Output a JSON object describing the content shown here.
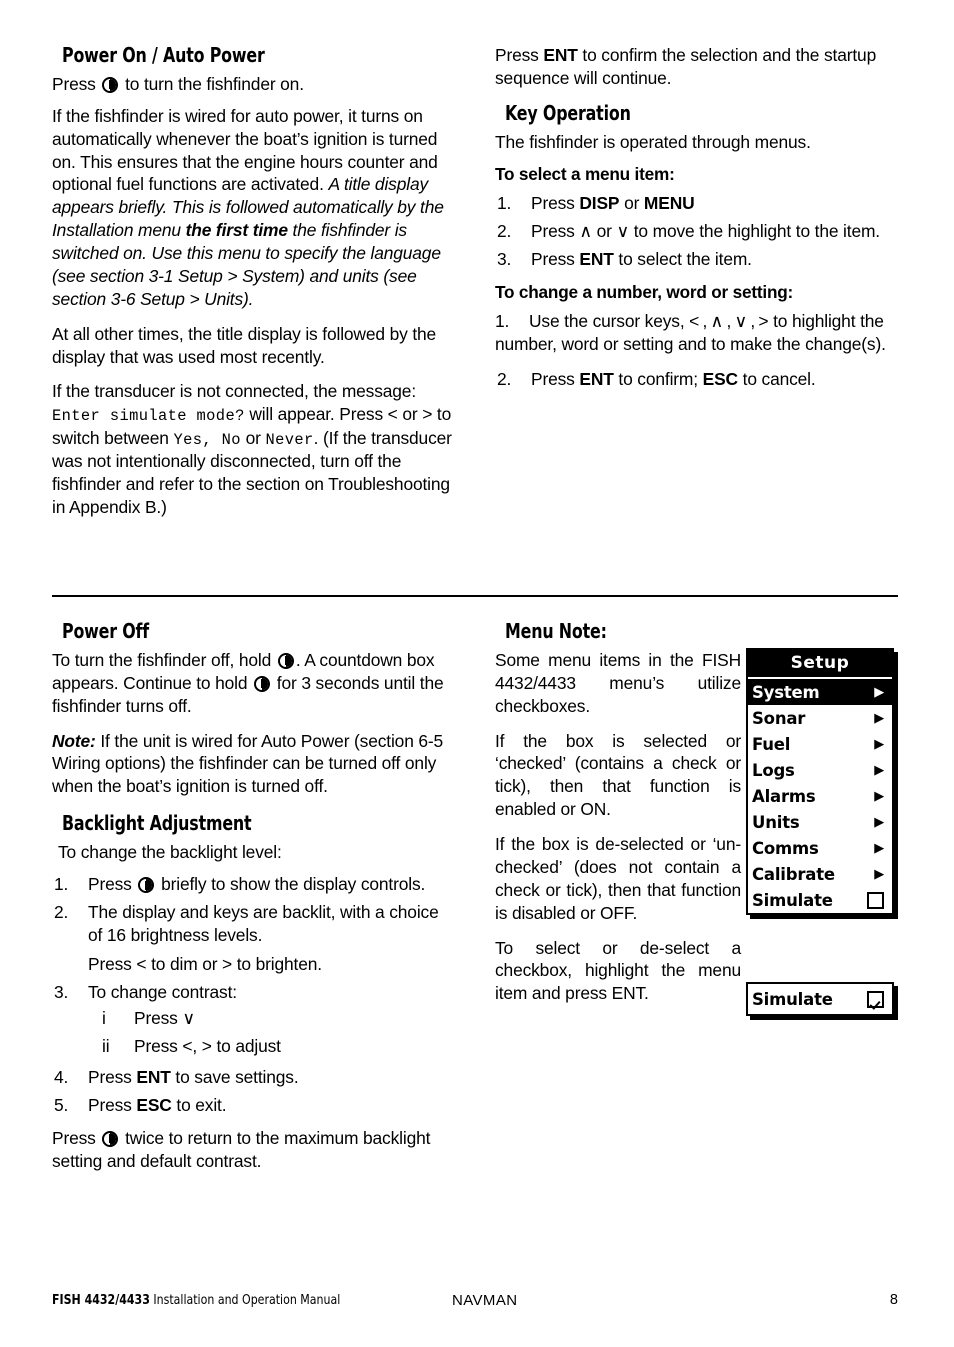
{
  "page": {
    "number": "8",
    "footer_left_bold": "FISH 4432/4433",
    "footer_left_rest": " Installation and Operation Manual",
    "footer_center": "NAVMAN"
  },
  "sections": {
    "power_on": {
      "heading": "Power On / Auto Power",
      "p1_a": "Press ",
      "p1_b": " to turn the fishfinder on.",
      "p2_roman": "If the fishfinder is wired for auto power, it turns on automatically whenever the boat’s ignition is turned on. This ensures that the engine hours counter and optional fuel functions are activated. ",
      "p2_italic_1": "A title display appears briefly. This is followed automatically by the Installation menu ",
      "p2_bold_italic": "the first time",
      "p2_italic_2": " the fishfinder is switched on. Use this menu to specify the language (see section 3-1 Setup > System) and units (see section 3-6 Setup > Units).",
      "p3": "At all other times, the title display is followed by the display that was used most recently.",
      "p4_a": "If the transducer is not connected, the message: ",
      "p4_mono_1": "Enter simulate mode?",
      "p4_b": " will appear. Press < or > to switch between ",
      "p4_mono_2": "Yes, No",
      "p4_c": " or ",
      "p4_mono_3": "Never",
      "p4_d": ". (If the transducer was not intentionally disconnected, turn off the fishfinder and refer to the section on Troubleshooting in Appendix B.)"
    },
    "key_operation": {
      "intro_a": "Press ",
      "intro_b": "ENT",
      "intro_c": " to confirm the selection and the startup sequence will continue.",
      "heading": "Key Operation",
      "lead": "The fishfinder is operated through menus.",
      "sub1": "To select a menu item:",
      "items1": [
        {
          "num": "1.",
          "pre": "Press ",
          "b1": "DISP",
          "mid": " or ",
          "b2": "MENU",
          "post": ""
        },
        {
          "num": "2.",
          "pre": "Press ∧ or ∨ to move the highlight to the item.",
          "b1": "",
          "mid": "",
          "b2": "",
          "post": ""
        },
        {
          "num": "3.",
          "pre": "Press ",
          "b1": "ENT",
          "mid": " to select the item.",
          "b2": "",
          "post": ""
        }
      ],
      "sub2": "To change a number, word or setting:",
      "item2_num": "1.",
      "item2_text": "Use the cursor keys, < , ∧ , ∨ , > to highlight the number, word or setting and to make the change(s).",
      "item3_num": "2.",
      "item3_pre": "Press ",
      "item3_b1": "ENT",
      "item3_mid": " to confirm; ",
      "item3_b2": "ESC",
      "item3_post": " to cancel."
    },
    "power_off": {
      "heading": "Power Off",
      "p1_a": "To turn the fishfinder off, hold ",
      "p1_b": ". A countdown box appears. Continue to hold ",
      "p1_c": " for 3 seconds until the fishfinder turns off.",
      "note_label": "Note:",
      "note_text": " If the unit is wired for Auto Power (section 6-5 Wiring options) the fishfinder can be turned off only when the boat’s ignition is turned off."
    },
    "backlight": {
      "heading": "Backlight Adjustment",
      "lead": "To change the backlight level:",
      "i1_num": "1.",
      "i1_a": "Press ",
      "i1_b": " briefly to show the display controls.",
      "i2_num": "2.",
      "i2_text": "The display and keys are backlit, with a choice of 16 brightness levels.",
      "i2_cont": "Press < to dim or > to brighten.",
      "i3_num": "3.",
      "i3_text": "To change contrast:",
      "i3a_num": "i",
      "i3a_text": "Press ∨",
      "i3b_num": "ii",
      "i3b_text": "Press <, > to adjust",
      "i4_num": "4.",
      "i4_pre": "Press ",
      "i4_b": "ENT",
      "i4_post": " to save settings.",
      "i5_num": "5.",
      "i5_pre": "Press ",
      "i5_b": "ESC",
      "i5_post": " to exit.",
      "closing_a": "Press ",
      "closing_b": " twice to return to the maximum backlight setting and default contrast."
    },
    "menu_note": {
      "heading": "Menu Note:",
      "p1": "Some menu items in the FISH 4432/4433 menu’s utilize checkboxes.",
      "p2": "If the box is selected or ‘checked’ (contains a check or tick), then that function is enabled or ON.",
      "p3": "If the box is de-selected or ‘un-checked’ (does not contain a check or tick), then that function is disabled or OFF.",
      "p4": "To select or de-select a checkbox, highlight the menu item and press ENT."
    }
  },
  "menu_screenshot": {
    "title": "Setup",
    "rows": [
      {
        "label": "System",
        "marker": "arrow",
        "selected": true
      },
      {
        "label": "Sonar",
        "marker": "arrow",
        "selected": false
      },
      {
        "label": "Fuel",
        "marker": "arrow",
        "selected": false
      },
      {
        "label": "Logs",
        "marker": "arrow",
        "selected": false
      },
      {
        "label": "Alarms",
        "marker": "arrow",
        "selected": false
      },
      {
        "label": "Units",
        "marker": "arrow",
        "selected": false
      },
      {
        "label": "Comms",
        "marker": "arrow",
        "selected": false
      },
      {
        "label": "Calibrate",
        "marker": "arrow",
        "selected": false
      },
      {
        "label": "Simulate",
        "marker": "checkbox",
        "checked": false,
        "selected": false
      }
    ],
    "arrow_glyph": "▶"
  },
  "simulate_screenshot": {
    "label": "Simulate",
    "checked": true
  }
}
